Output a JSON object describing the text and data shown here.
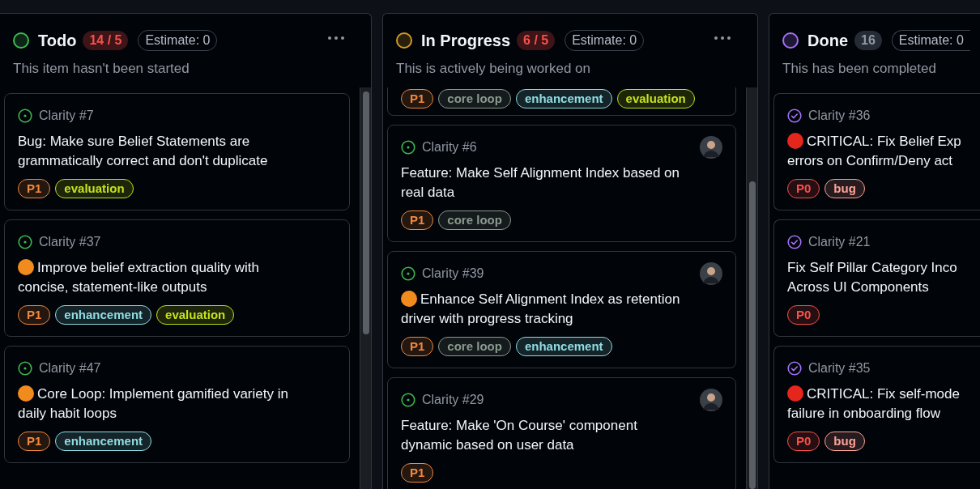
{
  "columns": [
    {
      "title": "Todo",
      "color": "#3fb950",
      "count": "14 / 5",
      "over_limit": true,
      "estimate": "Estimate: 0",
      "description": "This item hasn't been started",
      "scrolled": false,
      "cards": [
        {
          "kind": "full",
          "done": false,
          "ref": "Clarity #7",
          "assigned": false,
          "title_lines": [
            "Bug: Make sure Belief Statements are",
            "grammatically correct and don't duplicate"
          ],
          "labels": [
            {
              "text": "P1",
              "color": "#f0883e"
            },
            {
              "text": "evaluation",
              "color": "#c5e21c"
            }
          ]
        },
        {
          "kind": "full",
          "done": false,
          "ref": "Clarity #37",
          "assigned": false,
          "marker": {
            "color": "#f28b1e"
          },
          "title_lines": [
            "Improve belief extraction quality with",
            "concise, statement-like outputs"
          ],
          "labels": [
            {
              "text": "P1",
              "color": "#f0883e"
            },
            {
              "text": "enhancement",
              "color": "#8fdde3"
            },
            {
              "text": "evaluation",
              "color": "#c5e21c"
            }
          ]
        },
        {
          "kind": "full",
          "done": false,
          "ref": "Clarity #47",
          "assigned": false,
          "marker": {
            "color": "#f28b1e"
          },
          "title_lines": [
            "Core Loop: Implement gamified variety in",
            "daily habit loops"
          ],
          "labels": [
            {
              "text": "P1",
              "color": "#f0883e"
            },
            {
              "text": "enhancement",
              "color": "#8fdde3"
            }
          ]
        }
      ]
    },
    {
      "title": "In Progress",
      "color": "#d29922",
      "count": "6 / 5",
      "over_limit": true,
      "estimate": "Estimate: 0",
      "description": "This is actively being worked on",
      "scrolled": true,
      "cards": [
        {
          "kind": "labels_only",
          "labels": [
            {
              "text": "P1",
              "color": "#f0883e"
            },
            {
              "text": "core loop",
              "color": "#8b9a8f"
            },
            {
              "text": "enhancement",
              "color": "#8fdde3"
            },
            {
              "text": "evaluation",
              "color": "#c5e21c"
            }
          ]
        },
        {
          "kind": "full",
          "done": false,
          "ref": "Clarity #6",
          "assigned": true,
          "title_lines": [
            "Feature: Make Self Alignment Index based on",
            "real data"
          ],
          "labels": [
            {
              "text": "P1",
              "color": "#f0883e"
            },
            {
              "text": "core loop",
              "color": "#8b9a8f"
            }
          ]
        },
        {
          "kind": "full",
          "done": false,
          "ref": "Clarity #39",
          "assigned": true,
          "marker": {
            "color": "#f28b1e"
          },
          "title_lines": [
            "Enhance Self Alignment Index as retention",
            "driver with progress tracking"
          ],
          "labels": [
            {
              "text": "P1",
              "color": "#f0883e"
            },
            {
              "text": "core loop",
              "color": "#8b9a8f"
            },
            {
              "text": "enhancement",
              "color": "#8fdde3"
            }
          ]
        },
        {
          "kind": "full",
          "done": false,
          "ref": "Clarity #29",
          "assigned": true,
          "title_lines": [
            "Feature: Make 'On Course' component",
            "dynamic based on user data"
          ],
          "labels": [
            {
              "text": "P1",
              "color": "#f0883e"
            }
          ]
        }
      ]
    },
    {
      "title": "Done",
      "color": "#a371f7",
      "count": "16",
      "over_limit": false,
      "estimate": "Estimate: 0",
      "description": "This has been completed",
      "scrolled": false,
      "cards": [
        {
          "kind": "full",
          "done": true,
          "ref": "Clarity #36",
          "assigned": false,
          "marker": {
            "color": "#e5261c"
          },
          "title_lines": [
            "CRITICAL: Fix Belief Exp",
            "errors on Confirm/Deny act"
          ],
          "labels": [
            {
              "text": "P0",
              "color": "#f85149"
            },
            {
              "text": "bug",
              "color": "#ffa198"
            }
          ]
        },
        {
          "kind": "full",
          "done": true,
          "ref": "Clarity #21",
          "assigned": false,
          "title_lines": [
            "Fix Self Pillar Category Inco",
            "Across UI Components"
          ],
          "labels": [
            {
              "text": "P0",
              "color": "#f85149"
            }
          ]
        },
        {
          "kind": "full",
          "done": true,
          "ref": "Clarity #35",
          "assigned": false,
          "marker": {
            "color": "#e5261c"
          },
          "title_lines": [
            "CRITICAL: Fix self-mode",
            "failure in onboarding flow"
          ],
          "labels": [
            {
              "text": "P0",
              "color": "#f85149"
            },
            {
              "text": "bug",
              "color": "#ffa198"
            }
          ]
        }
      ]
    }
  ]
}
